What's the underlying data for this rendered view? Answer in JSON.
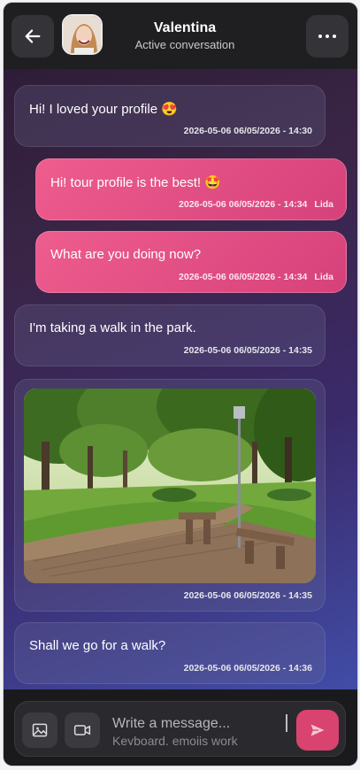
{
  "header": {
    "back_icon": "arrow-left-icon",
    "name": "Valentina",
    "status": "Active conversation",
    "more_icon": "more-horizontal-icon"
  },
  "messages": [
    {
      "direction": "in",
      "text": "Hi! I loved your profile 😍",
      "meta": "2026-05-06 06/05/2026 - 14:30",
      "sender": ""
    },
    {
      "direction": "out",
      "text": "Hi! tour profile is the best! 🤩",
      "meta": "2026-05-06 06/05/2026 - 14:34",
      "sender": "Lida"
    },
    {
      "direction": "out",
      "text": "What are you doing now?",
      "meta": "2026-05-06 06/05/2026 - 14:34",
      "sender": "Lida"
    },
    {
      "direction": "in",
      "text": "I'm taking a walk in the park.",
      "meta": "2026-05-06 06/05/2026 - 14:35",
      "sender": ""
    },
    {
      "direction": "in",
      "type": "image",
      "meta": "2026-05-06 06/05/2026 - 14:35",
      "sender": ""
    },
    {
      "direction": "in",
      "text": "Shall we go for a walk?",
      "meta": "2026-05-06 06/05/2026 - 14:36",
      "sender": ""
    }
  ],
  "composer": {
    "image_icon": "image-icon",
    "video_icon": "video-camera-icon",
    "placeholder": "Write a message...",
    "hint": "Keyboard, emojis work",
    "send_icon": "send-icon"
  },
  "colors": {
    "outgoing_bubble": "#e04f84",
    "send_button": "#d8436f",
    "header_bg": "#1f1f22"
  }
}
